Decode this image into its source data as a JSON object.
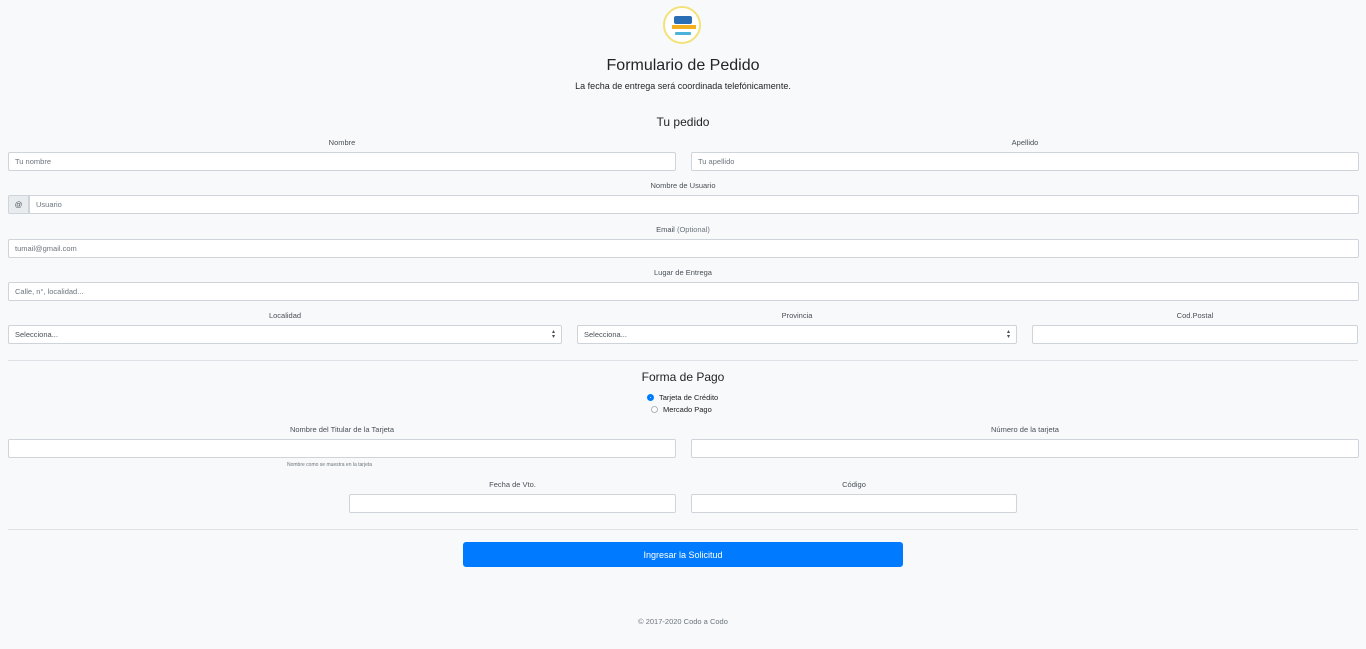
{
  "header": {
    "logo_icon": "codo-a-codo-logo",
    "title": "Formulario de Pedido",
    "subtitle": "La fecha de entrega será coordinada telefónicamente."
  },
  "order": {
    "section_title": "Tu pedido",
    "first_name": {
      "label": "Nombre",
      "placeholder": "Tu nombre"
    },
    "last_name": {
      "label": "Apellido",
      "placeholder": "Tu apellido"
    },
    "username": {
      "label": "Nombre de Usuario",
      "prefix": "@",
      "placeholder": "Usuario"
    },
    "email": {
      "label": "Email",
      "optional": "(Optional)",
      "placeholder": "tumail@gmail.com"
    },
    "address": {
      "label": "Lugar de Entrega",
      "placeholder": "Calle, n°, localidad..."
    },
    "locality": {
      "label": "Localidad",
      "value": "Selecciona..."
    },
    "province": {
      "label": "Provincia",
      "value": "Selecciona..."
    },
    "postal_code": {
      "label": "Cod.Postal",
      "value": ""
    }
  },
  "payment": {
    "section_title": "Forma de Pago",
    "options": [
      {
        "label": "Tarjeta de Crédito",
        "selected": true
      },
      {
        "label": "Mercado Pago",
        "selected": false
      }
    ],
    "card_holder": {
      "label": "Nombre del Titular de la Tarjeta",
      "help": "Nombre como se muestra en la tarjeta"
    },
    "card_number": {
      "label": "Número de la tarjeta"
    },
    "expiry": {
      "label": "Fecha de Vto."
    },
    "code": {
      "label": "Código"
    }
  },
  "submit": {
    "label": "Ingresar la Solicitud"
  },
  "footer": {
    "text": "© 2017-2020 Codo a Codo"
  },
  "colors": {
    "primary": "#007bff",
    "background": "#f8f9fa",
    "border": "#ced4da"
  }
}
